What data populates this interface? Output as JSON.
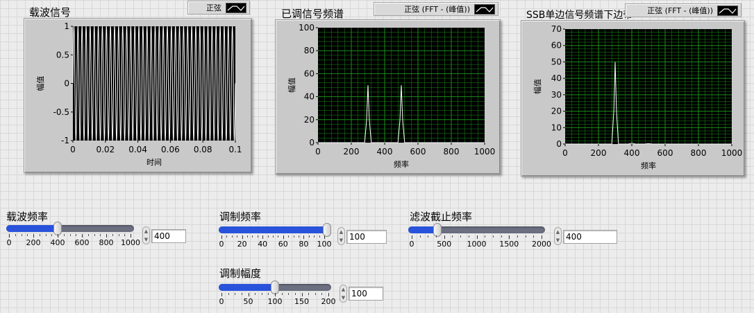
{
  "colors": {
    "plot_bg": "#000000",
    "plot_trace": "#ffffff",
    "grid": "#1a8f1a",
    "slider_fill": "#2953db",
    "slider_track": "#6b6f80"
  },
  "chart_data": [
    {
      "type": "line",
      "title": "载波信号",
      "legend_label": "正弦",
      "xlabel": "时间",
      "ylabel": "幅值",
      "xlim": [
        0,
        0.1
      ],
      "ylim": [
        -1,
        1
      ],
      "grid": false,
      "x_ticks": [
        "0",
        "0.02",
        "0.04",
        "0.06",
        "0.08",
        "0.1"
      ],
      "y_ticks": [
        "1",
        "0.5",
        "0",
        "-0.5",
        "-1"
      ],
      "signal": {
        "kind": "sine",
        "frequency": 400,
        "amplitude": 1
      }
    },
    {
      "type": "line",
      "title": "已调信号频谱",
      "legend_label": "正弦 (FFT - (峰值))",
      "xlabel": "频率",
      "ylabel": "幅值",
      "xlim": [
        0,
        1000
      ],
      "ylim": [
        0,
        100
      ],
      "grid": true,
      "x_ticks": [
        "0",
        "200",
        "400",
        "600",
        "800",
        "1000"
      ],
      "y_ticks": [
        "100",
        "80",
        "60",
        "40",
        "20",
        "0"
      ],
      "series": [
        {
          "x": [
            0,
            280,
            292,
            300,
            308,
            320,
            480,
            492,
            500,
            508,
            520,
            1000
          ],
          "y": [
            0,
            0,
            20,
            50,
            20,
            0,
            0,
            20,
            50,
            20,
            0,
            0
          ]
        }
      ]
    },
    {
      "type": "line",
      "title": "SSB单边信号频谱下边带",
      "legend_label": "正弦 (FFT - (峰值))",
      "xlabel": "频率",
      "ylabel": "幅值",
      "xlim": [
        0,
        1000
      ],
      "ylim": [
        0,
        70
      ],
      "grid": true,
      "x_ticks": [
        "0",
        "200",
        "400",
        "600",
        "800",
        "1000"
      ],
      "y_ticks": [
        "70",
        "60",
        "50",
        "40",
        "30",
        "20",
        "10",
        "0"
      ],
      "series": [
        {
          "x": [
            0,
            280,
            292,
            300,
            308,
            320,
            380,
            390,
            400,
            410,
            420,
            480,
            500,
            520,
            1000
          ],
          "y": [
            0,
            0,
            20,
            50,
            20,
            0,
            0,
            0.3,
            0.5,
            0.3,
            0,
            0,
            0.3,
            0,
            0
          ]
        }
      ]
    }
  ],
  "controls": {
    "carrier_freq": {
      "label": "载波频率",
      "value": "400",
      "min": 0,
      "max": 1000,
      "level": 400,
      "ticks": [
        "0",
        "200",
        "400",
        "600",
        "800",
        "1000"
      ]
    },
    "mod_freq": {
      "label": "调制频率",
      "value": "100",
      "min": 0,
      "max": 100,
      "level": 100,
      "ticks": [
        "0",
        "20",
        "40",
        "60",
        "80",
        "100"
      ]
    },
    "mod_amp": {
      "label": "调制幅度",
      "value": "100",
      "min": 0,
      "max": 200,
      "level": 100,
      "ticks": [
        "0",
        "50",
        "100",
        "150",
        "200"
      ]
    },
    "cutoff_freq": {
      "label": "滤波截止频率",
      "value": "400",
      "min": 0,
      "max": 2000,
      "level": 400,
      "ticks": [
        "0",
        "500",
        "1000",
        "1500",
        "2000"
      ]
    }
  }
}
